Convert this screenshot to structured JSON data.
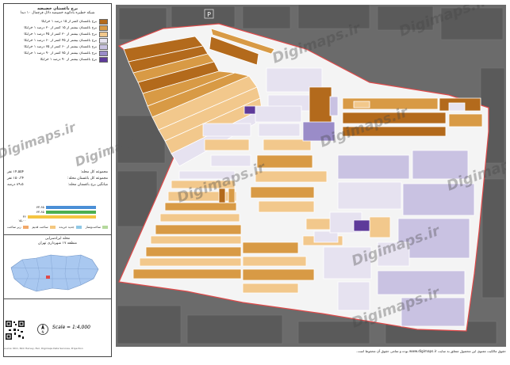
{
  "header": {
    "title": "برج باغستان خضیضه",
    "subtitle": "شبکه خطیره بادکوبه خضیضه دلال فرچمال ۱۰ دیدا"
  },
  "legend": {
    "items": [
      {
        "label": "برج باغستان کمتر از ۱۵ درصد ۱ خرابکا",
        "color": "#b36a1c"
      },
      {
        "label": "برج باغستان بیشتر از ۱۵ کمتر از ۳۰ درصد ۱ خرابکا",
        "color": "#d89a45"
      },
      {
        "label": "برج باغستان بیشتر از ۳۰ کمتر از ۴۵ درصد ۱ خرابکا",
        "color": "#f2c88c"
      },
      {
        "label": "برج باغستان بیشتر از ۴۵ کمتر از ۶۰ درصد ۱ خرابکا",
        "color": "#e6e2f0"
      },
      {
        "label": "برج باغستان بیشتر از ۶۰ کمتر از ۷۵ درصد ۱ خرابکا",
        "color": "#c9c2e2"
      },
      {
        "label": "برج باغستان بیشتر از ۷۵ کمتر از ۹۰ درصد ۱ خرابکا",
        "color": "#9a8cc8"
      },
      {
        "label": "برج باغستان بیشتر از ۹۰ درصد ۱ خرابکا",
        "color": "#5e3a9a"
      }
    ]
  },
  "stats": [
    {
      "label": "مجموعه کل محله:",
      "value": "۱۴،۵۵۴ نفر"
    },
    {
      "label": "مجموعه کل باغستان محله:",
      "value": "۱۵۰،۳۴ نفر"
    },
    {
      "label": "میانگین برج باغستان محله:",
      "value": "۸۹،۵ درصد"
    }
  ],
  "bars": {
    "labels": [
      "۷۳،۶۵",
      "۷۳،۶۵",
      "۳۶ ۱۵،۰۰"
    ],
    "values": [
      73.65,
      73.65,
      100
    ],
    "colors": [
      "#4a8fd6",
      "#4caf50",
      "#f5c542"
    ]
  },
  "categories": [
    {
      "label": "ساخت‌وساز",
      "color": "#b5d99c"
    },
    {
      "label": "جدید خریده",
      "color": "#8fc8e6"
    },
    {
      "label": "ساخت قدیم",
      "color": "#f4c77e"
    },
    {
      "label": "زیر ساخت",
      "color": "#f2a96a"
    }
  ],
  "location": {
    "title1": "محله ایرادسرایی",
    "title2": "منطقه ۱۷ شهرداری تهران"
  },
  "scale": {
    "text": "Scale = 1:4,000"
  },
  "north_icon": "north-arrow-icon",
  "credit": {
    "text": "Source: NCC, NCC Harvey, Esri, Digimaps Data Services, Projection"
  },
  "map": {
    "watermark": "Digimaps.ir",
    "boundary_color": "#e04a4a",
    "parking_label": "P"
  },
  "notice": {
    "text": "حقوق مالکیت معنوی این محصول متعلق به سایت www.digimaps.ir بوده و تمامی حقوق آن محفوظ است."
  }
}
